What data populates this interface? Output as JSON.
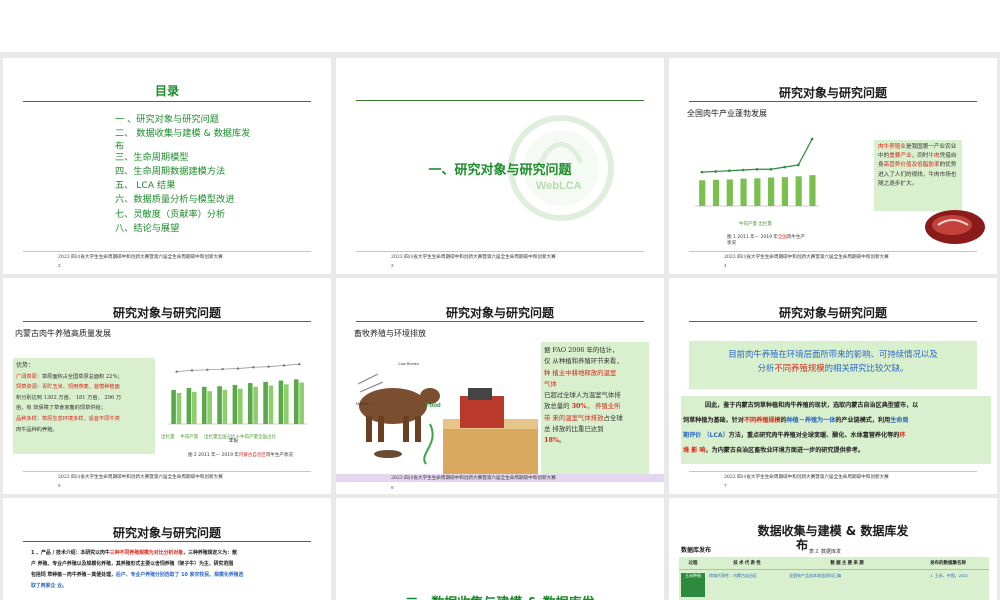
{
  "slides": {
    "s1": {
      "title": "目录",
      "items": [
        "一 、研究对象与研究问题",
        "二、 数据收集与建模 & 数据库发",
        "布",
        "三、生命周期模型",
        "四、生命周期数据建模方法",
        "五、 LCA 结果",
        "六、数据质量分析与模型改进",
        "七、灵敏度（贡献率）分析",
        "八、结论与展望"
      ],
      "footer": "2023 四川省大学生生命周期碳中和创新大赛暨第六届全生命周期碳中和创新大赛",
      "page": "2"
    },
    "s2": {
      "title": "一、研究对象与研究问题",
      "watermark": "WebLCA",
      "footer": "2023 四川省大学生生命周期碳中和创新大赛暨第六届全生命周期碳中和创新大赛",
      "page": "3"
    },
    "s3": {
      "title": "研究对象与研究问题",
      "subtitle": "全国肉牛产业蓬勃发展",
      "box_a": "肉牛养殖业",
      "box_b": "是我国第一产业农业中的",
      "box_c": "重要产业",
      "box_d": "，同时",
      "box_e": "牛肉",
      "box_f": "凭借自身",
      "box_g": "高营养价值及低脂肪率",
      "box_h": "的优势进入了人们的视线，牛肉市场也随之逐步扩大。",
      "legend": "牛肉产量   出栏量",
      "caption_a": "图 1 2011 年— 2019 年",
      "caption_b": "全国",
      "caption_c": "肉牛生产",
      "caption_d": "状况",
      "footer": "2023 四川省大学生生命周期碳中和创新大赛暨第六届全生命周期碳中和创新大赛",
      "page": "4"
    },
    "s4": {
      "title": "研究对象与研究问题",
      "subtitle": "内蒙古肉牛养殖高质量发展",
      "adv": "优势：",
      "l1a": "广阔草原：",
      "l1b": "草原面积占全国草原总面积 22%；",
      "l2a": "饲草资源：",
      "l2b": "青贮玉米、饲用燕麦、苜蓿种植面",
      "l3": "积分别达到 1302 万亩、 181 万亩、 296 万",
      "l4": "亩，有 效保障了草食家畜的饲草供给；",
      "l5a": "品种多样：",
      "l5b": "草原生态环境多样，适宜不同牛类",
      "l6": "肉牛品种的养殖。",
      "legend_a": "出栏量",
      "legend_b": "牛肉产量",
      "legend_c": "出栏量全国占比十牛肉产量全国占比",
      "xlabel": "年份",
      "caption_a": "图 2 2011 年— 2019 年",
      "caption_b": "内蒙古自治区",
      "caption_c": "肉牛生产状况",
      "footer": "2023 四川省大学生生命周期碳中和创新大赛暨第六届全生命周期碳中和创新大赛",
      "page": "5"
    },
    "s5": {
      "title": "研究对象与研究问题",
      "subtitle": "畜牧养殖与环境排放",
      "cow_label": "Cow Rumen",
      "manure_label": "Manure",
      "food_label": "Food",
      "t1": "据 FAO 2006 年的估计，",
      "t2a": "仅 从种植和养殖环节来看，",
      "t3a": "种 植业中耕地释放的温室",
      "t4": "气体",
      "t5": "已超过全球人为温室气体排",
      "t6a": "放总量的 ",
      "t6b": "30%",
      "t6c": "， 养殖业所",
      "t7a": "带 来的温室气体排放",
      "t7b": "占全球",
      "t8": "总 排放的比重已达到",
      "t9": "18%",
      "t9b": "。",
      "footer": "2023 四川省大学生生命周期碳中和创新大赛暨第六届全生命周期碳中和创新大赛",
      "page": "6"
    },
    "s6": {
      "title": "研究对象与研究问题",
      "q1": "目前肉牛养殖在环境层面所带来的影响、可持续情况以及",
      "q2a": "分析",
      "q2b": "不同养殖规模",
      "q2c": "的相关研究比较欠缺。",
      "p1": "因此，鉴于内蒙古饲草种植和肉牛养殖的现状，选取内蒙古自治区典型盟市，以",
      "p2a": "饲草种植为基础，针对",
      "p2b": "不同养殖规模",
      "p2c": "的",
      "p2d": "种植－养殖为一体",
      "p2e": "的产业链模式，利用",
      "p2f": "生命周",
      "p3a": "期评价 （LCA）",
      "p3b": "方法，重点研究肉牛养殖对全球变暖、酸化、水体富营养化等的",
      "p3c": "环",
      "p4a": "境 影 响",
      "p4b": "，为内蒙古自治区畜牧业环境方面进一步的研究提供参考。",
      "footer": "2023 四川省大学生生命周期碳中和创新大赛暨第六届全生命周期碳中和创新大赛",
      "page": "7"
    },
    "s7": {
      "title": "研究对象与研究问题",
      "l1a": "1 、产品 / 技术介绍：",
      "l1b": "本研究以肉牛",
      "l1c": "三种不同养殖规模为对比分析对象",
      "l1d": "，三种养殖规定义为：散",
      "l2": "户 养殖、专业户养殖以及规模化养殖，其养殖形式主要以舍饲养殖（架子牛）为主，研究范围",
      "l3a": "包括饲 草种植－肉牛养殖－粪便处理，",
      "l3b": "后户、专业户养殖分别选取了 10 家农牧民、规模化养殖选",
      "l4": "取了两家企 业。"
    },
    "s8": {
      "title": "二、数据收集与建模 & 数据库发"
    },
    "s9": {
      "title_a": "数据收集与建模 & 数据库发",
      "title_b": "布",
      "left_label": "数据库发布",
      "caption": "表 2. 数据库发",
      "h1": "过程",
      "h2": "技 术 代 表 性",
      "h3": "数 据 主 要 来 源",
      "h4": "发布的数据集名称",
      "r1c1": "玉米种植",
      "r1c2": "地域代表性：内蒙古自治区",
      "r1c3": "全国农产品成本收益资料汇编",
      "r1c4": "1. 玉米，中国，2023"
    }
  },
  "chart_data": [
    {
      "type": "bar",
      "title": "",
      "series": [
        {
          "name": "牛肉产量",
          "values": [
            6.5,
            6.6,
            6.7,
            6.9,
            7.0,
            7.2,
            7.3,
            7.5,
            7.8
          ]
        },
        {
          "name": "出栏量",
          "values": [
            4.7,
            4.8,
            4.9,
            5.0,
            5.1,
            5.1,
            5.4,
            5.7,
            9.3
          ]
        }
      ]
    },
    {
      "type": "bar",
      "title": "",
      "xlabel": "年份",
      "series": [
        {
          "name": "出栏量",
          "values": [
            55,
            58,
            60,
            61,
            63,
            66,
            68,
            70,
            72
          ]
        },
        {
          "name": "牛肉产量",
          "values": [
            50,
            52,
            53,
            55,
            57,
            60,
            62,
            64,
            67
          ]
        },
        {
          "name": "出栏量全国占比十牛肉产量全国占比",
          "values": [
            78,
            80,
            81,
            82,
            83,
            85,
            86,
            88,
            90
          ]
        }
      ]
    }
  ]
}
